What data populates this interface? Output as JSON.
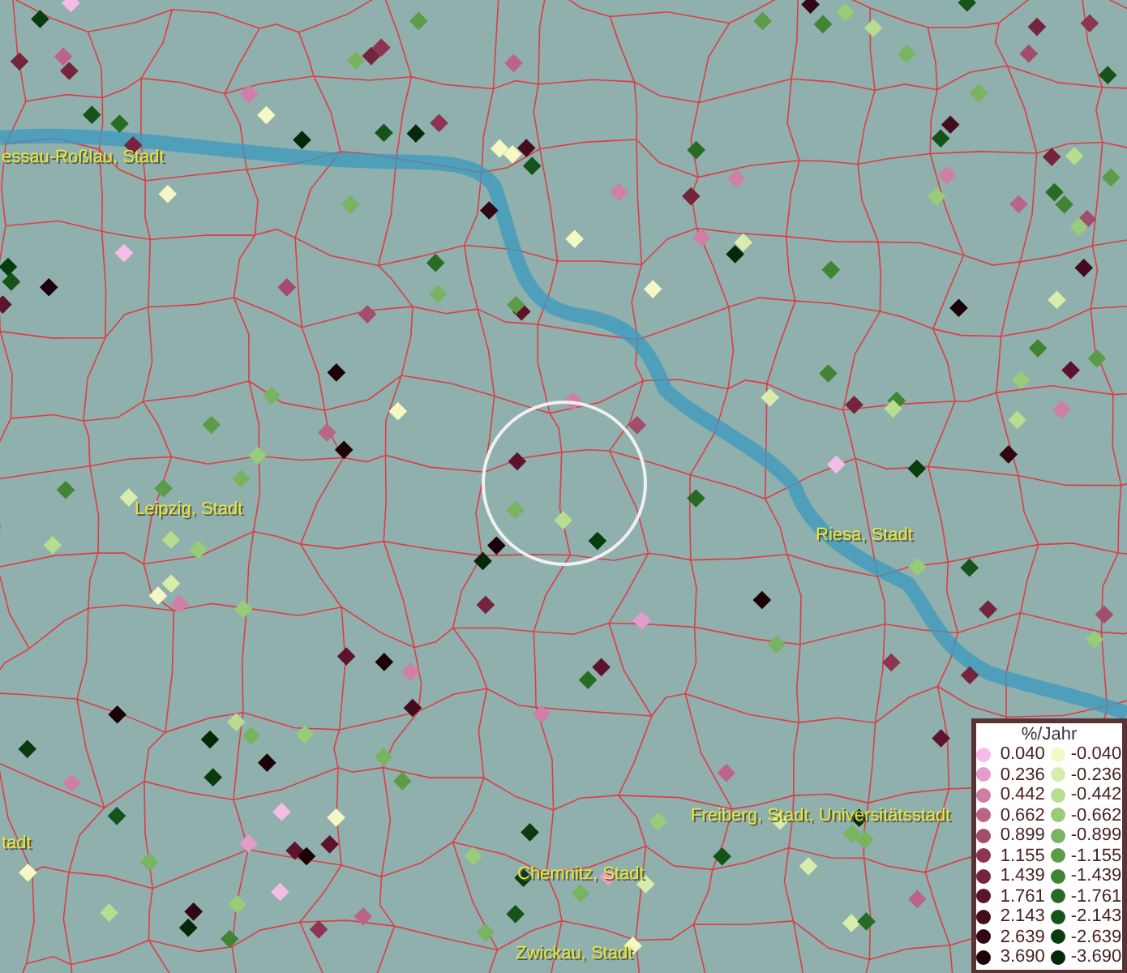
{
  "map_labels": [
    {
      "text": "essau-Roßlau, Stadt"
    },
    {
      "text": "Leipzig, Stadt"
    },
    {
      "text": "Riesa, Stadt"
    },
    {
      "text": "tadt"
    },
    {
      "text": "Freiberg, Stadt, Universitätsstadt"
    },
    {
      "text": "Chemnitz, Stadt"
    },
    {
      "text": "Zwickau, Stadt"
    }
  ],
  "legend": {
    "title": "%/Jahr",
    "entries": [
      {
        "value": "0.040",
        "color": "#f6bce8"
      },
      {
        "value": "0.236",
        "color": "#e49cc8"
      },
      {
        "value": "0.442",
        "color": "#d07ea8"
      },
      {
        "value": "0.662",
        "color": "#bc6488"
      },
      {
        "value": "0.899",
        "color": "#a44c6c"
      },
      {
        "value": "1.155",
        "color": "#8c3450"
      },
      {
        "value": "1.439",
        "color": "#74243c"
      },
      {
        "value": "1.761",
        "color": "#5c142a"
      },
      {
        "value": "2.143",
        "color": "#440c1c"
      },
      {
        "value": "2.639",
        "color": "#300612"
      },
      {
        "value": "3.690",
        "color": "#1c0208"
      },
      {
        "value": "-0.040",
        "color": "#f4f8c4"
      },
      {
        "value": "-0.236",
        "color": "#d8ecac"
      },
      {
        "value": "-0.442",
        "color": "#b8dc90"
      },
      {
        "value": "-0.662",
        "color": "#98cc78"
      },
      {
        "value": "-0.899",
        "color": "#78b460"
      },
      {
        "value": "-1.155",
        "color": "#5c9c48"
      },
      {
        "value": "-1.439",
        "color": "#408434"
      },
      {
        "value": "-1.761",
        "color": "#286c24"
      },
      {
        "value": "-2.143",
        "color": "#145418"
      },
      {
        "value": "-2.639",
        "color": "#083c0e"
      },
      {
        "value": "-3.690",
        "color": "#042808"
      }
    ]
  }
}
